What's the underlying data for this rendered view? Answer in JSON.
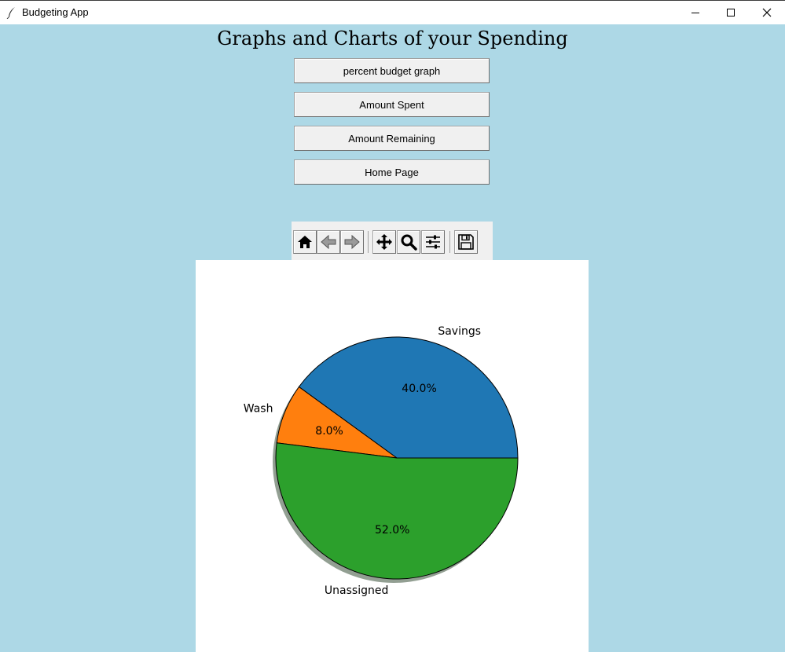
{
  "window": {
    "title": "Budgeting App",
    "icon": "feather-icon"
  },
  "page": {
    "heading": "Graphs and Charts of your Spending"
  },
  "buttons": {
    "percent_budget_graph": "percent budget graph",
    "amount_spent": "Amount Spent",
    "amount_remaining": "Amount Remaining",
    "home_page": "Home Page"
  },
  "toolbar": {
    "items": [
      "home-icon",
      "back-arrow-icon",
      "forward-arrow-icon",
      "pan-move-icon",
      "zoom-magnifier-icon",
      "configure-subplots-icon",
      "save-floppy-icon"
    ]
  },
  "colors": {
    "background": "#add8e6",
    "savings": "#1f77b4",
    "wash": "#ff7f0e",
    "unassigned": "#2ca02c"
  },
  "chart_data": {
    "type": "pie",
    "shadow": true,
    "start_angle_deg": 0,
    "slices": [
      {
        "label": "Savings",
        "value": 40.0,
        "pct_label": "40.0%",
        "color": "#1f77b4"
      },
      {
        "label": "Wash",
        "value": 8.0,
        "pct_label": "8.0%",
        "color": "#ff7f0e"
      },
      {
        "label": "Unassigned",
        "value": 52.0,
        "pct_label": "52.0%",
        "color": "#2ca02c"
      }
    ]
  }
}
